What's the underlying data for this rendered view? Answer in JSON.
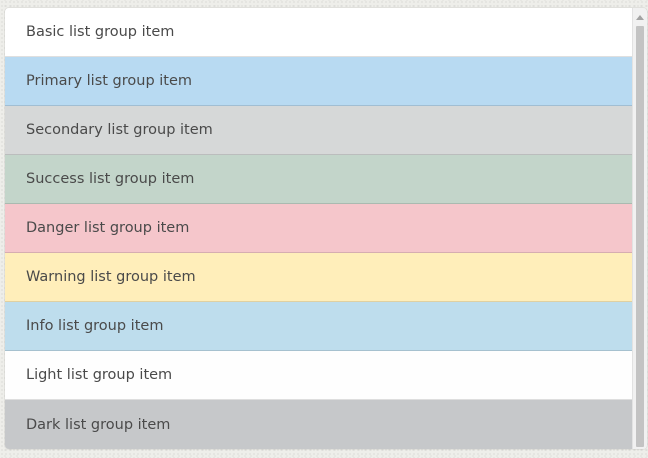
{
  "list_group": {
    "items": [
      {
        "label": "Basic list group item",
        "variant": "basic",
        "bg": "#ffffff"
      },
      {
        "label": "Primary list group item",
        "variant": "primary",
        "bg": "#b8daf2"
      },
      {
        "label": "Secondary list group item",
        "variant": "secondary",
        "bg": "#d6d8d8"
      },
      {
        "label": "Success list group item",
        "variant": "success",
        "bg": "#c3d5ca"
      },
      {
        "label": "Danger list group item",
        "variant": "danger",
        "bg": "#f5c6cb"
      },
      {
        "label": "Warning list group item",
        "variant": "warning",
        "bg": "#ffeeba"
      },
      {
        "label": "Info list group item",
        "variant": "info",
        "bg": "#bedded"
      },
      {
        "label": "Light list group item",
        "variant": "light",
        "bg": "#fefefe"
      },
      {
        "label": "Dark list group item",
        "variant": "dark",
        "bg": "#c6c8ca"
      }
    ]
  },
  "scrollbar": {
    "arrow_icon": "triangle-up-icon",
    "track_color": "#f1f1f1",
    "thumb_color": "#c3c3c3"
  }
}
